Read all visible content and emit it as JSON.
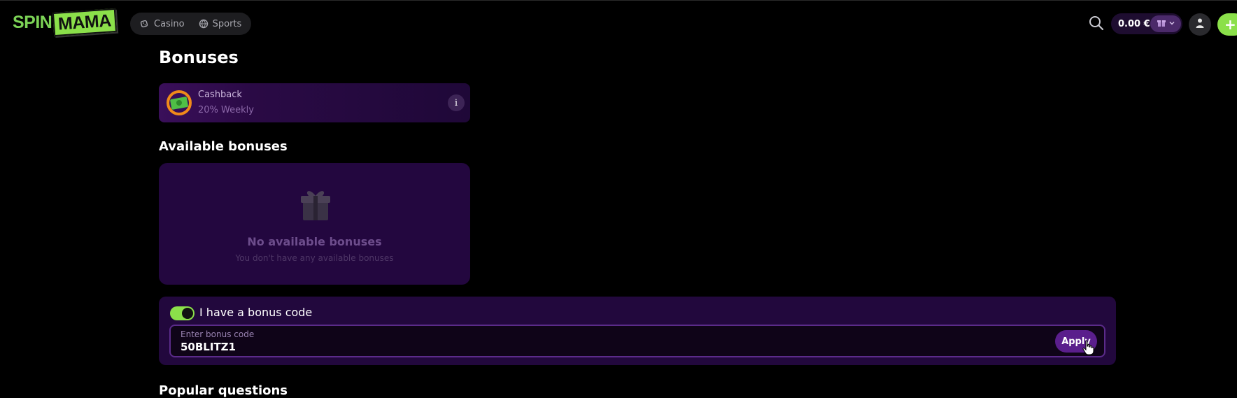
{
  "header": {
    "logo_left": "SPIN",
    "logo_right": "MAMA",
    "nav": [
      {
        "label": "Casino",
        "icon": "dice-icon"
      },
      {
        "label": "Sports",
        "icon": "ball-icon"
      }
    ],
    "balance": "0.00 €"
  },
  "page": {
    "title": "Bonuses"
  },
  "cashback": {
    "title": "Cashback",
    "subtitle": "20% Weekly",
    "info": "i"
  },
  "available": {
    "title": "Available bonuses",
    "empty_title": "No available bonuses",
    "empty_subtitle": "You don't have any available bonuses"
  },
  "bonus_code": {
    "toggle_label": "I have a bonus code",
    "toggle_on": true,
    "input_label": "Enter bonus code",
    "value": "50BLITZ1",
    "apply_label": "Apply"
  },
  "faq": {
    "title": "Popular questions"
  },
  "colors": {
    "accent_green": "#8be04a",
    "card_purple": "#23073f",
    "button_purple": "#5a1e8c"
  }
}
